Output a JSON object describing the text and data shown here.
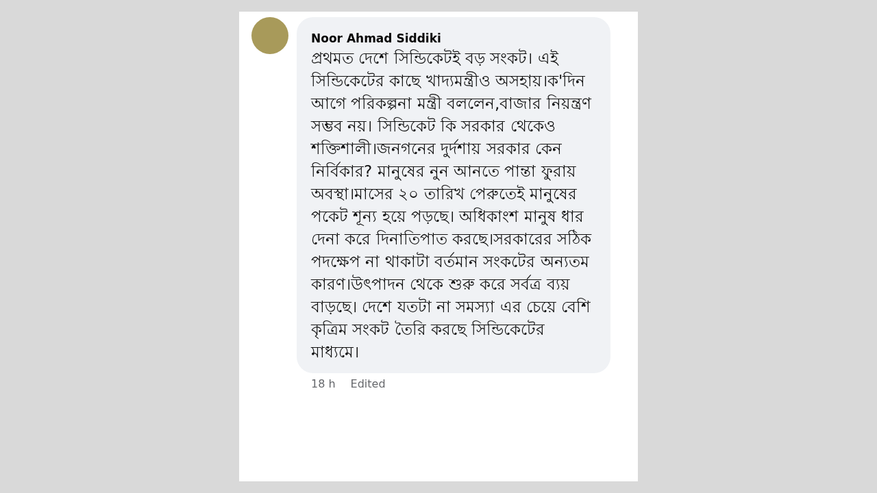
{
  "comment": {
    "author": "Noor Ahmad Siddiki",
    "text": "প্রথমত দেশে সিন্ডিকেটই বড় সংকট। এই সিন্ডিকেটের কাছে খাদ্যমন্ত্রীও অসহায়।ক'দিন আগে পরিকল্পনা মন্ত্রী বললেন,বাজার নিয়ন্ত্রণ সম্ভব নয়। সিন্ডিকেট কি সরকার থেকেও শক্তিশালী।জনগনের দুর্দশায় সরকার কেন নির্বিকার? মানুষের নুন আনতে পান্তা ফুরায় অবস্থা।মাসের ২০ তারিখ পেরুতেই মানুষের পকেট শূন্য হয়ে পড়ছে। অধিকাংশ মানুষ ধার দেনা করে দিনাতিপাত করছে।সরকারের সঠিক পদক্ষেপ না থাকাটা বর্তমান সংকটের অন্যতম কারণ।উৎপাদন থেকে শুরু করে সর্বত্র ব্যয় বাড়ছে। দেশে যতটা না সমস্যা এর চেয়ে বেশি কৃত্রিম সংকট তৈরি করছে সিন্ডিকেটের মাধ্যমে।",
    "time": "18 h",
    "edited": "Edited"
  }
}
